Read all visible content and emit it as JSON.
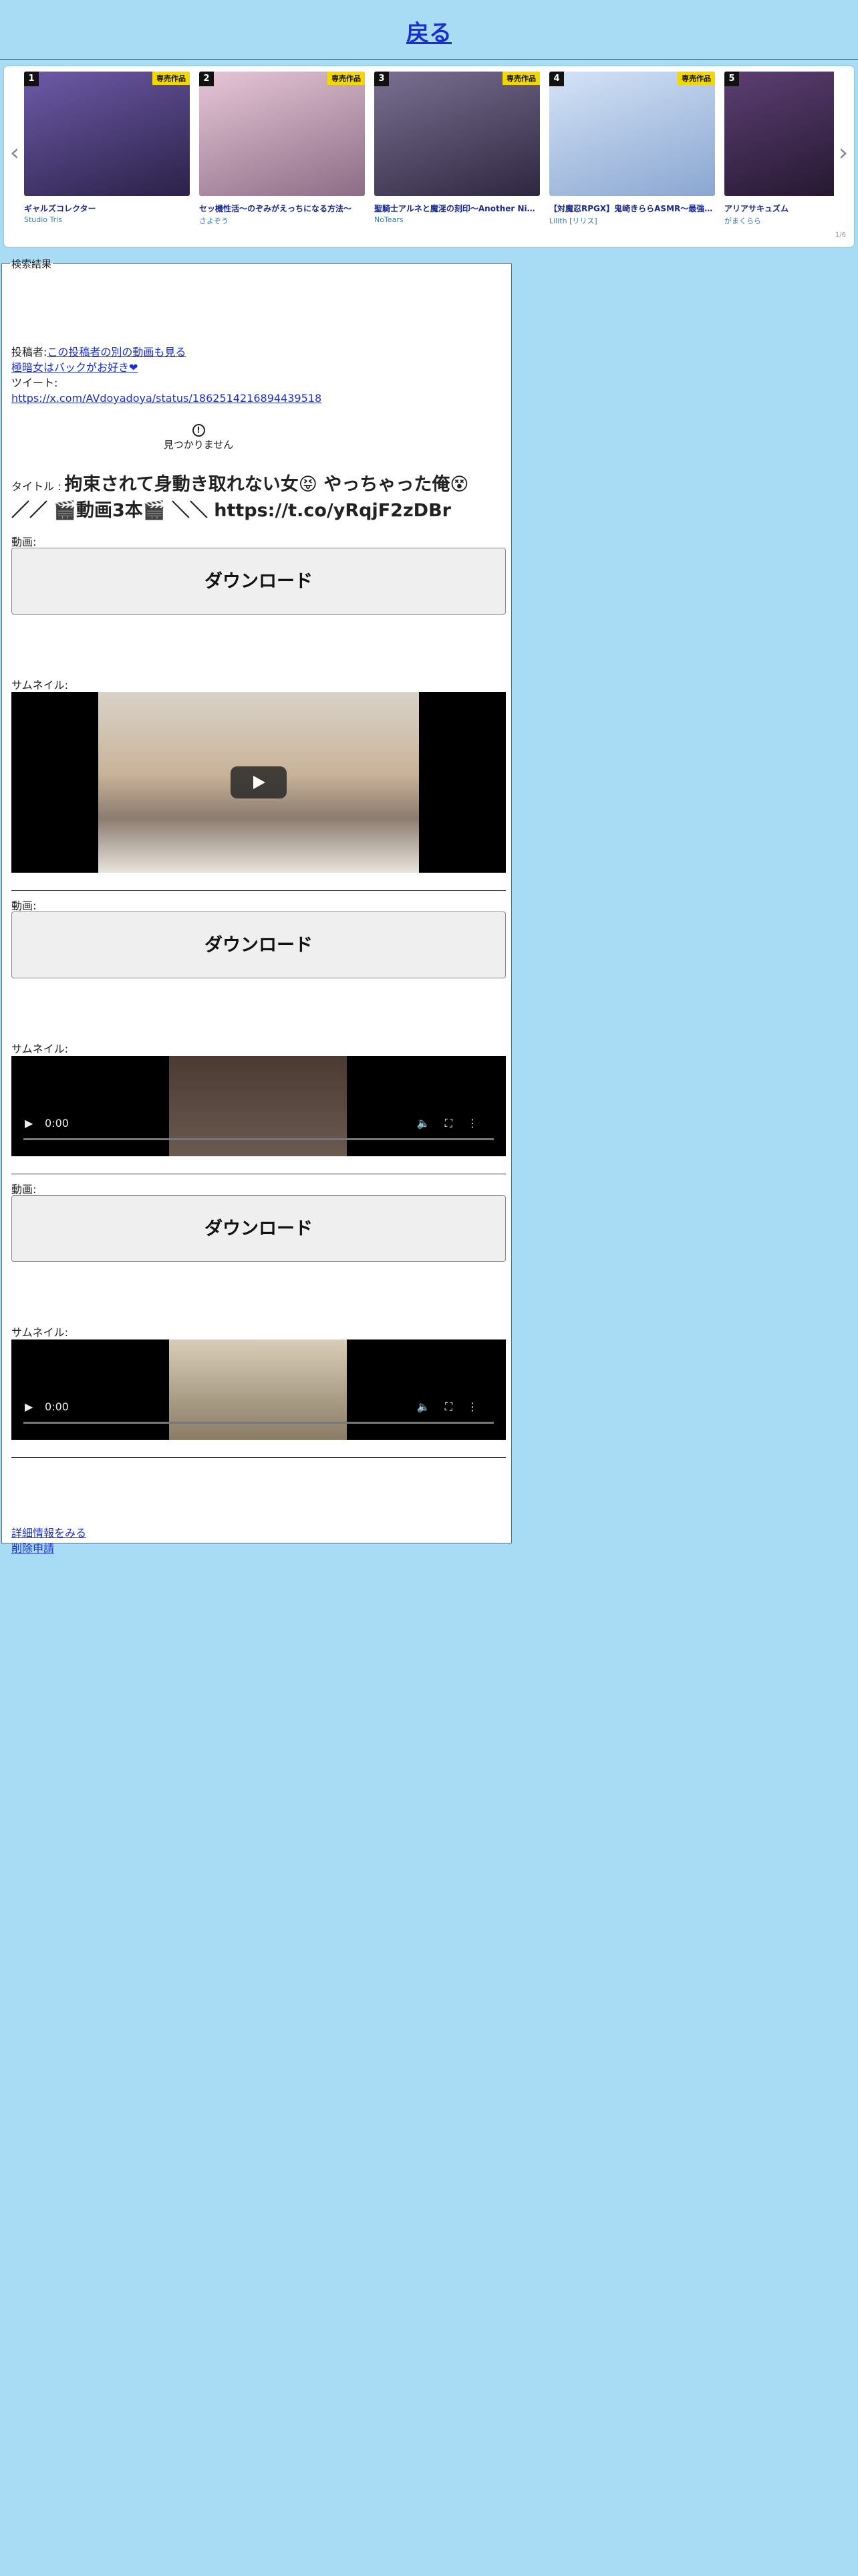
{
  "header": {
    "back_label": "戻る"
  },
  "carousel": {
    "pager": "1/6",
    "items": [
      {
        "rank": "1",
        "badge": "専売作品",
        "title": "ギャルズコレクター",
        "author": "Studio Tris",
        "thumb_color": "#4b3a78"
      },
      {
        "rank": "2",
        "badge": "専売作品",
        "title": "セッ機性活〜のぞみがえっちになる方法〜",
        "author": "さよぞう",
        "thumb_color": "#c9a5b8"
      },
      {
        "rank": "3",
        "badge": "専売作品",
        "title": "聖騎士アルネと魔淫の刻印〜Another Night〜",
        "author": "NoTears",
        "thumb_color": "#5a4f6e"
      },
      {
        "rank": "4",
        "badge": "専売作品",
        "title": "【対魔忍RPGX】鬼崎きららASMR〜最強の…",
        "author": "Lilith [リリス]",
        "thumb_color": "#a9c3e6"
      },
      {
        "rank": "5",
        "badge": "",
        "title": "アリアサキュズム",
        "author": "がまくらら",
        "thumb_color": "#3d2a4f"
      }
    ]
  },
  "results": {
    "legend": "検索結果",
    "poster_label": "投稿者:",
    "poster_link": "この投稿者の別の動画も見る",
    "poster_name": "極暗女はバックがお好き❤",
    "tweet_label": "ツイート:",
    "tweet_url": "https://x.com/AVdoyadoya/status/1862514216894439518",
    "not_found_icon": "!",
    "not_found": "見つかりません",
    "title_label": "タイトル : ",
    "title_text": "拘束されて身動き取れない女😝 やっちゃった俺😵 ／／ 🎬動画3本🎬 ＼＼ https://t.co/yRqjF2zDBr",
    "video_label": "動画:",
    "thumb_label": "サムネイル:",
    "download_label": "ダウンロード",
    "time": "0:00",
    "details_link": "詳細情報をみる",
    "delete_link": "削除申請"
  }
}
